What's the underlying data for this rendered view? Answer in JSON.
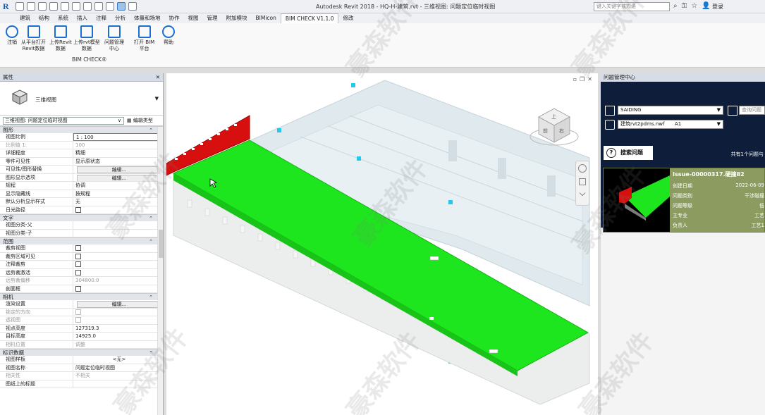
{
  "app": {
    "title": "Autodesk Revit 2018  -  HQ-H-建筑.rvt - 三维视图: 问题定位临时视图",
    "search_placeholder": "键入关键字或短语",
    "login_label": "登录"
  },
  "tabs": [
    "建筑",
    "结构",
    "系统",
    "插入",
    "注释",
    "分析",
    "体量和场地",
    "协作",
    "视图",
    "管理",
    "附加模块",
    "BIMicon",
    "BIM CHECK V1.1.0",
    "修改"
  ],
  "active_tab": "BIM CHECK V1.1.0",
  "ribbon": {
    "buttons": [
      {
        "label": "注销",
        "icon": "power-icon"
      },
      {
        "label": "从平台打开\nRevit数据",
        "icon": "open-from-platform-icon"
      },
      {
        "label": "上传Revit\n数据",
        "icon": "upload-revit-icon"
      },
      {
        "label": "上传rvt模型\n数据",
        "icon": "upload-rvt-icon"
      },
      {
        "label": "问题管理\n中心",
        "icon": "issue-center-icon"
      },
      {
        "label": "打开 BIM\n平台",
        "icon": "bim-platform-icon"
      },
      {
        "label": "帮助",
        "icon": "help-icon"
      }
    ],
    "group_label": "BIM CHECK®"
  },
  "properties": {
    "header": "属性",
    "type_name": "三维视图",
    "selector": "三维视图: 问题定位临时视图",
    "edit_type": "编辑类型",
    "sections": [
      {
        "title": "图形",
        "rows": [
          {
            "k": "视图比例",
            "v": "1 : 100",
            "kind": "input"
          },
          {
            "k": "比例值 1:",
            "v": "100",
            "dim": true
          },
          {
            "k": "详细程度",
            "v": "精细"
          },
          {
            "k": "零件可见性",
            "v": "显示原状态"
          },
          {
            "k": "可见性/图形替换",
            "v": "编辑...",
            "kind": "button"
          },
          {
            "k": "图形显示选项",
            "v": "编辑...",
            "kind": "button"
          },
          {
            "k": "规程",
            "v": "协调"
          },
          {
            "k": "显示隐藏线",
            "v": "按规程"
          },
          {
            "k": "默认分析显示样式",
            "v": "无"
          },
          {
            "k": "日光路径",
            "v": "",
            "kind": "check"
          }
        ]
      },
      {
        "title": "文字",
        "rows": [
          {
            "k": "视图分类-父",
            "v": ""
          },
          {
            "k": "视图分类-子",
            "v": ""
          }
        ]
      },
      {
        "title": "范围",
        "rows": [
          {
            "k": "裁剪视图",
            "v": "",
            "kind": "check"
          },
          {
            "k": "裁剪区域可见",
            "v": "",
            "kind": "check"
          },
          {
            "k": "注释裁剪",
            "v": "",
            "kind": "check"
          },
          {
            "k": "远剪裁激活",
            "v": "",
            "kind": "check"
          },
          {
            "k": "远剪裁偏移",
            "v": "304800.0",
            "dim": true
          },
          {
            "k": "剖面框",
            "v": "",
            "kind": "check"
          }
        ]
      },
      {
        "title": "相机",
        "rows": [
          {
            "k": "渲染设置",
            "v": "编辑...",
            "kind": "button"
          },
          {
            "k": "锁定的方向",
            "v": "",
            "kind": "check",
            "dim": true
          },
          {
            "k": "透视图",
            "v": "",
            "kind": "check",
            "dim": true
          },
          {
            "k": "视点高度",
            "v": "127319.3"
          },
          {
            "k": "目标高度",
            "v": "14925.0"
          },
          {
            "k": "相机位置",
            "v": "调整",
            "dim": true
          }
        ]
      },
      {
        "title": "标识数据",
        "rows": [
          {
            "k": "视图样板",
            "v": "<无>",
            "kind": "center"
          },
          {
            "k": "视图名称",
            "v": "问题定位临时视图"
          },
          {
            "k": "相关性",
            "v": "不相关",
            "dim": true
          },
          {
            "k": "图纸上的标题",
            "v": ""
          }
        ]
      }
    ]
  },
  "viewcube": {
    "face_top": "上",
    "face_front": "前",
    "face_right": "右"
  },
  "issue_center": {
    "header": "问题管理中心",
    "project": "SAIDING",
    "search_field_placeholder": "查询问题",
    "model_file": "建筑rvt2pdms.nwf",
    "model_view": "A1",
    "search_button": "搜索问题",
    "count_text": "共有1个问题与",
    "issue": {
      "title": "Issue-00000317.硬撞82",
      "fields": [
        {
          "k": "创建日期",
          "v": "2022-06-09"
        },
        {
          "k": "问题类别",
          "v": "干涉碰撞"
        },
        {
          "k": "问题等级",
          "v": "低"
        },
        {
          "k": "主专业",
          "v": "工艺"
        },
        {
          "k": "负责人",
          "v": "工艺1"
        }
      ]
    }
  },
  "watermark": "豪森软件",
  "colors": {
    "accent": "#1e5aa8",
    "clash_green": "#1ee61e",
    "clash_red": "#d80f0f",
    "issue_dark": "#0d1d3a",
    "card": "#8c9c60"
  }
}
